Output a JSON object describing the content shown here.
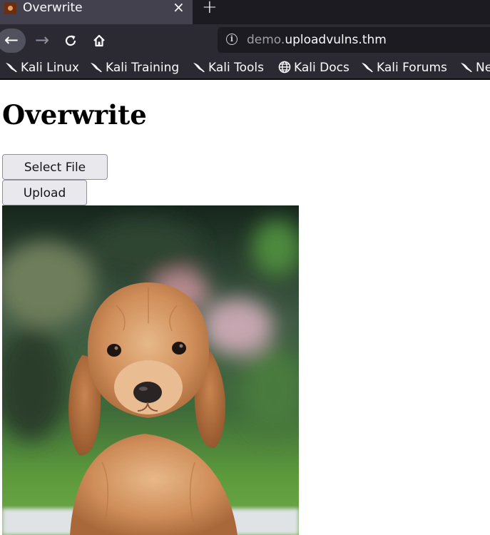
{
  "browser": {
    "tab": {
      "title": "Overwrite",
      "close_glyph": "×"
    },
    "new_tab_glyph": "+",
    "nav": {
      "back": "←",
      "forward": "→",
      "reload": "⟳"
    },
    "url": {
      "prefix": "demo.",
      "host": "uploadvulns.thm"
    },
    "bookmarks": [
      {
        "label": "Kali Linux",
        "icon": "kali-dragon-icon"
      },
      {
        "label": "Kali Training",
        "icon": "kali-dragon-icon"
      },
      {
        "label": "Kali Tools",
        "icon": "kali-dragon-icon"
      },
      {
        "label": "Kali Docs",
        "icon": "globe-icon"
      },
      {
        "label": "Kali Forums",
        "icon": "kali-dragon-icon"
      },
      {
        "label": "Ne",
        "icon": "kali-dragon-icon"
      }
    ]
  },
  "page": {
    "title": "Overwrite",
    "select_button": "Select File",
    "upload_button": "Upload",
    "image": {
      "subject": "cocker-spaniel-puppy-photo"
    }
  },
  "colors": {
    "chrome_dark": "#1c1b22",
    "chrome_toolbar": "#2b2a33",
    "tab_active": "#42414d",
    "button_bg": "#e9e9ed"
  }
}
